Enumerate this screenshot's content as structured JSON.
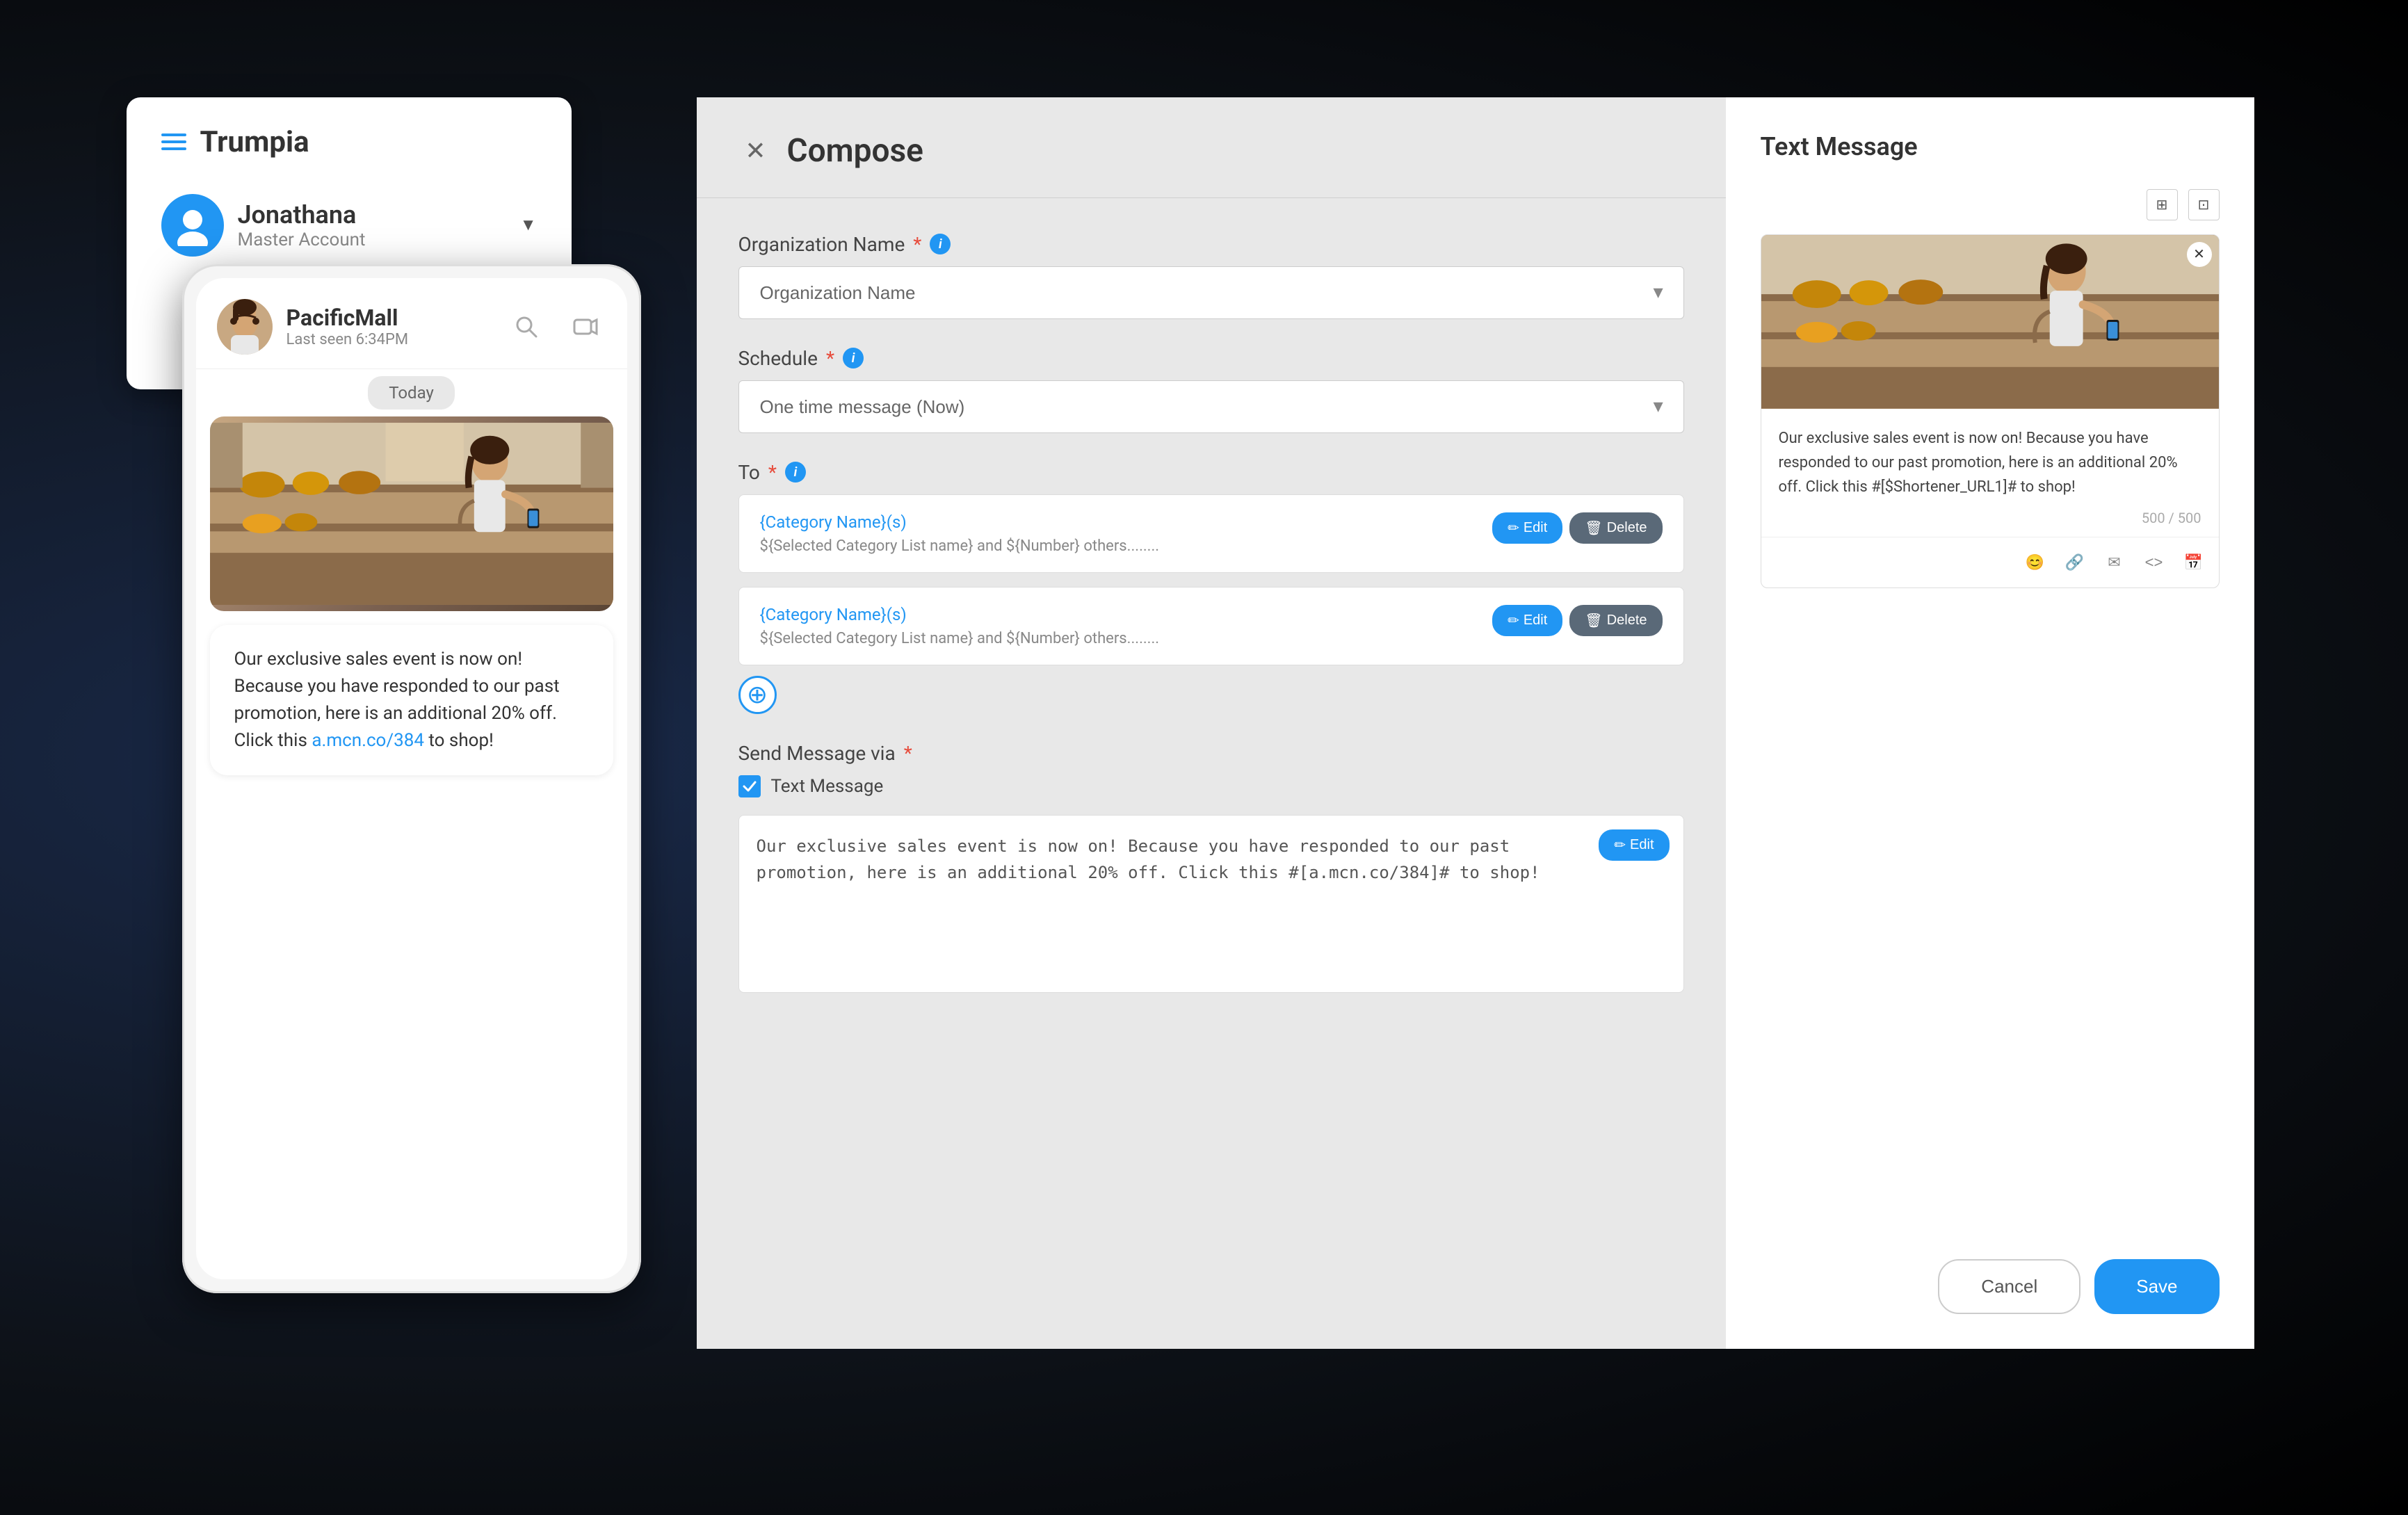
{
  "app": {
    "name": "Trumpia"
  },
  "sidebar": {
    "title": "Trumpia",
    "user": {
      "name": "Jonathana",
      "role": "Master Account"
    }
  },
  "mobile": {
    "contact_name": "PacificMall",
    "contact_status": "Last seen 6:34PM",
    "today_label": "Today",
    "message_text": "Our exclusive sales event is now on! Because you have responded to our past promotion, here is an additional 20% off. Click this ",
    "message_link": "a.mcn.co/384",
    "message_suffix": " to shop!"
  },
  "compose": {
    "title": "Compose",
    "organization_label": "Organization Name",
    "organization_placeholder": "Organization Name",
    "schedule_label": "Schedule",
    "schedule_value": "One time message (Now)",
    "to_label": "To",
    "send_via_label": "Send Message via",
    "text_message_label": "Text Message",
    "category_items": [
      {
        "name": "{Category Name}(s)",
        "detail": "${Selected Category List name} and ${Number} others........",
        "edit_label": "Edit",
        "delete_label": "Delete"
      },
      {
        "name": "{Category Name}(s)",
        "detail": "${Selected Category List name} and ${Number} others........",
        "edit_label": "Edit",
        "delete_label": "Delete"
      }
    ],
    "message_body": "Our exclusive sales event is now on! Because you have responded to our past promotion, here is an additional 20% off. Click this #[a.mcn.co/384]# to shop!",
    "edit_label": "Edit",
    "add_more_tooltip": "Add more"
  },
  "preview": {
    "title": "Text Message",
    "message_text": "Our exclusive sales event is now on! Because you have responded to our past promotion, here is an additional 20% off. Click this #[$Shortener_URL1]# to shop!",
    "char_count": "500 / 500",
    "close_label": "×",
    "cancel_label": "Cancel",
    "save_label": "Save"
  }
}
